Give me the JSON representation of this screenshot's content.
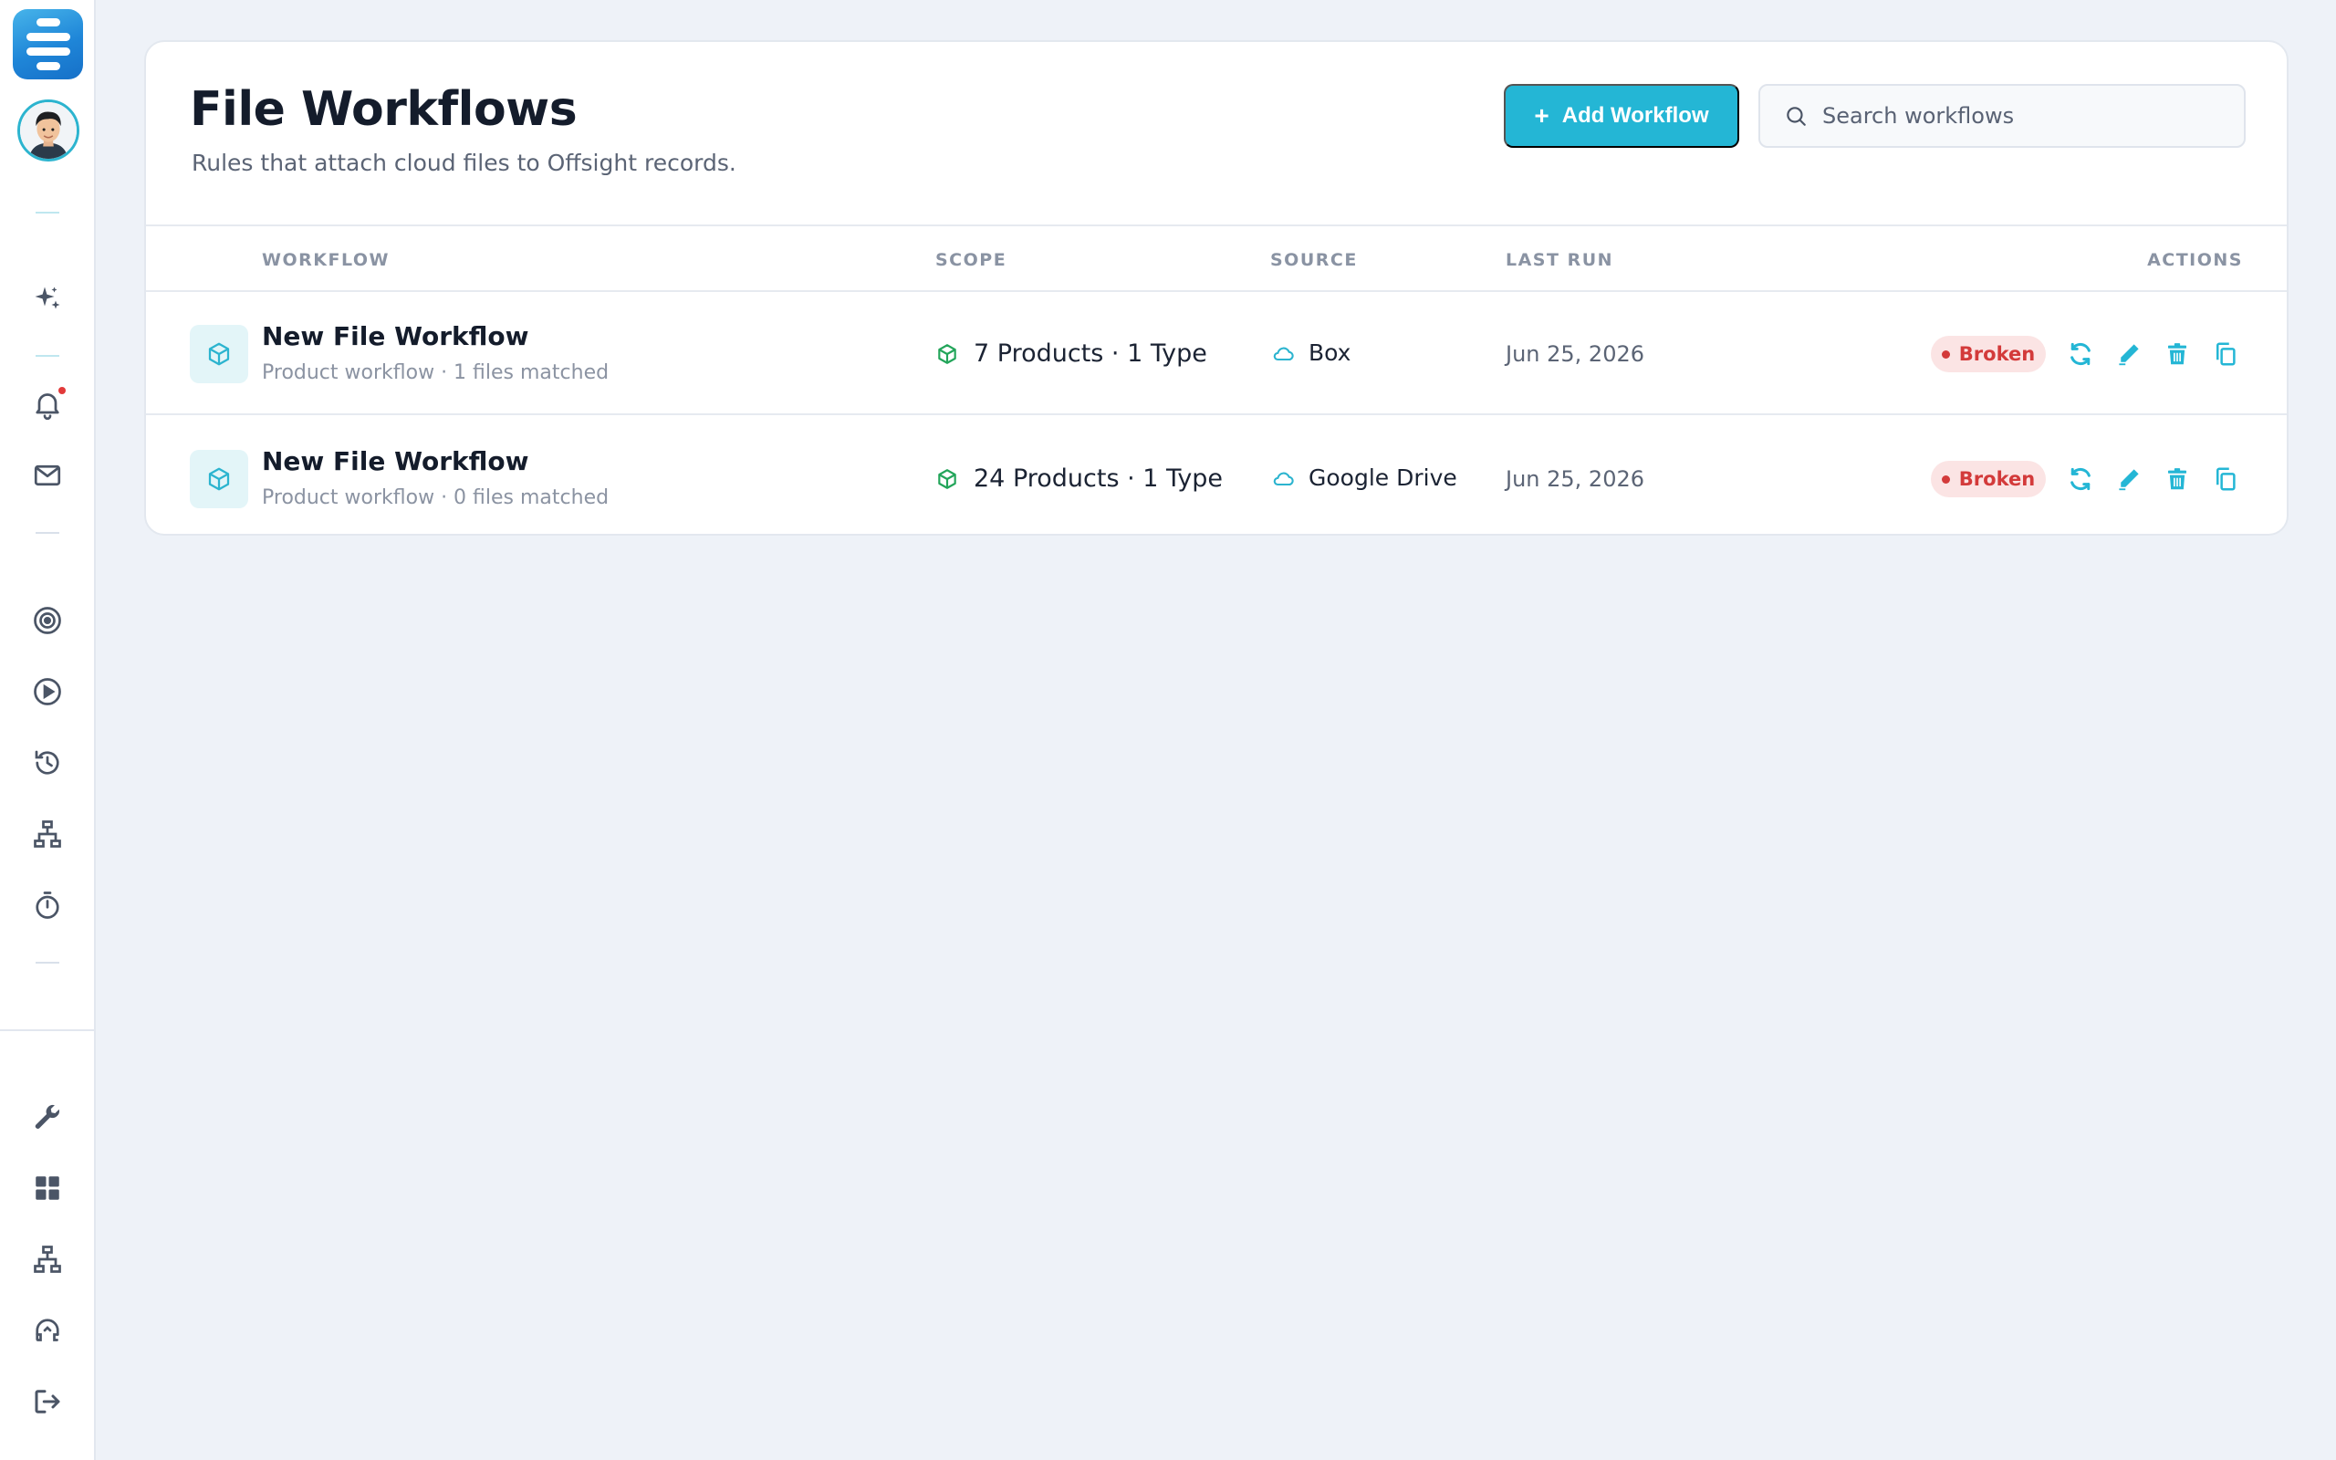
{
  "colors": {
    "accent": "#24b6d5",
    "broken": "#d33a3a",
    "broken_bg": "#fbe4e4",
    "scope_green": "#23a55a"
  },
  "sidebar": {
    "top_icons": [
      "sparkle-icon",
      "bell-icon",
      "mail-icon"
    ],
    "middle_icons": [
      "target-icon",
      "play-icon",
      "history-icon",
      "hierarchy-icon",
      "timer-icon"
    ],
    "bottom_icons": [
      "wrench-icon",
      "dashboard-icon",
      "network-icon",
      "support-icon",
      "logout-icon"
    ]
  },
  "header": {
    "title": "File Workflows",
    "subtitle": "Rules that attach cloud files to Offsight records.",
    "add_button_label": "Add Workflow",
    "search_placeholder": "Search workflows"
  },
  "table": {
    "columns": {
      "workflow": "WORKFLOW",
      "scope": "SCOPE",
      "source": "SOURCE",
      "last_run": "LAST RUN",
      "actions": "ACTIONS"
    },
    "rows": [
      {
        "name": "New File Workflow",
        "meta": "Product workflow · 1 files matched",
        "scope": "7 Products · 1 Type",
        "source": "Box",
        "last_run": "Jun 25, 2026",
        "status": "Broken"
      },
      {
        "name": "New File Workflow",
        "meta": "Product workflow · 0 files matched",
        "scope": "24 Products · 1 Type",
        "source": "Google Drive",
        "last_run": "Jun 25, 2026",
        "status": "Broken"
      }
    ]
  }
}
